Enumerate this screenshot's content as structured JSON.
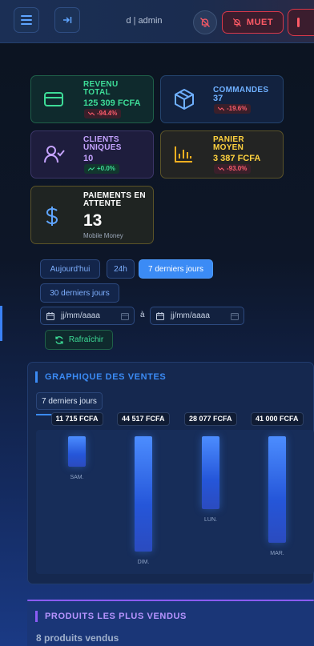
{
  "header": {
    "user": "d | admin",
    "mute_label": "MUET"
  },
  "stats": {
    "revenue": {
      "title": "REVENU TOTAL",
      "value": "125 309 FCFA",
      "change": "-94.4%"
    },
    "orders": {
      "title": "COMMANDES",
      "value": "37",
      "change": "-19.6%"
    },
    "customers": {
      "title": "CLIENTS UNIQUES",
      "value": "10",
      "change": "+0.0%"
    },
    "basket": {
      "title": "PANIER MOYEN",
      "value": "3 387 FCFA",
      "change": "-93.0%"
    },
    "pending": {
      "title": "PAIEMENTS EN ATTENTE",
      "value": "13",
      "subtitle": "Mobile Money"
    }
  },
  "filters": {
    "today": "Aujourd'hui",
    "h24": "24h",
    "days7": "7 derniers jours",
    "days30": "30 derniers jours",
    "date_from_placeholder": "jj/mm/aaaa",
    "date_sep": "à",
    "date_to_placeholder": "jj/mm/aaaa",
    "refresh": "Rafraîchir"
  },
  "sales": {
    "title": "GRAPHIQUE DES VENTES",
    "period": "7 derniers jours"
  },
  "chart_data": {
    "type": "bar",
    "title": "GRAPHIQUE DES VENTES",
    "categories": [
      "SAM.",
      "DIM.",
      "LUN.",
      "MAR."
    ],
    "values": [
      11715,
      44517,
      28077,
      41000
    ],
    "value_labels": [
      "11 715 FCFA",
      "44 517 FCFA",
      "28 077 FCFA",
      "41 000 FCFA"
    ],
    "xlabel": "",
    "ylabel": "",
    "grid": false,
    "bar_color": "#3b82f6"
  },
  "products": {
    "title": "PRODUITS LES PLUS VENDUS",
    "count": "8 produits vendus"
  },
  "colors": {
    "accent": "#3b8bf5",
    "green": "#3ddc97",
    "red": "#ff5a66",
    "purple": "#c5a3ff",
    "yellow": "#ffd23f"
  }
}
